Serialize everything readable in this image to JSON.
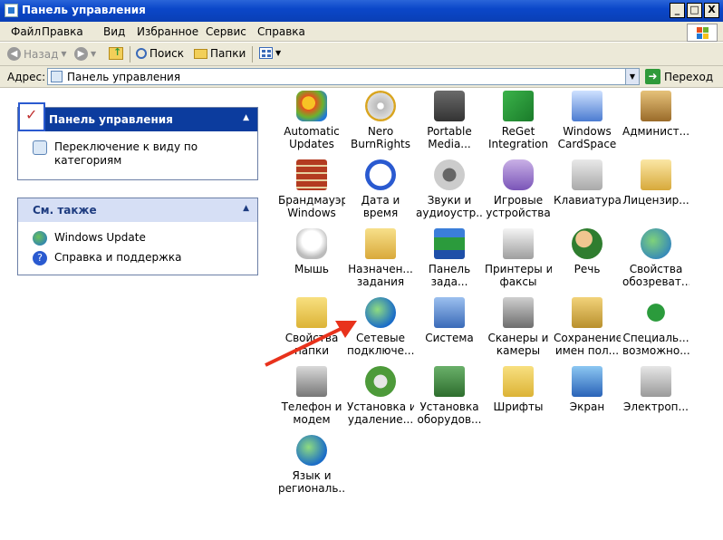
{
  "window": {
    "title": "Панель управления",
    "buttons": {
      "minimize": "_",
      "maximize": "□",
      "close": "X"
    }
  },
  "menu": [
    "Файл",
    "Правка",
    "Вид",
    "Избранное",
    "Сервис",
    "Справка"
  ],
  "toolbar": {
    "back": "Назад",
    "search": "Поиск",
    "folders": "Папки"
  },
  "address": {
    "label": "Адрес:",
    "value": "Панель управления",
    "go": "Переход"
  },
  "sidebar": {
    "panel1": {
      "title": "Панель управления",
      "link": "Переключение к виду по категориям"
    },
    "panel2": {
      "title": "См. также",
      "links": [
        "Windows Update",
        "Справка и поддержка"
      ]
    }
  },
  "icons": [
    {
      "line1": "Automatic",
      "line2": "Updates"
    },
    {
      "line1": "Nero",
      "line2": "BurnRights"
    },
    {
      "line1": "Portable",
      "line2": "Media..."
    },
    {
      "line1": "ReGet",
      "line2": "Integration"
    },
    {
      "line1": "Windows",
      "line2": "CardSpace"
    },
    {
      "line1": "Админист...",
      "line2": ""
    },
    {
      "line1": "Брандмауэр",
      "line2": "Windows"
    },
    {
      "line1": "Дата и",
      "line2": "время"
    },
    {
      "line1": "Звуки и",
      "line2": "аудиоустр..."
    },
    {
      "line1": "Игровые",
      "line2": "устройства"
    },
    {
      "line1": "Клавиатура",
      "line2": ""
    },
    {
      "line1": "Лицензир...",
      "line2": ""
    },
    {
      "line1": "Мышь",
      "line2": ""
    },
    {
      "line1": "Назначен...",
      "line2": "задания"
    },
    {
      "line1": "Панель",
      "line2": "зада..."
    },
    {
      "line1": "Принтеры и",
      "line2": "факсы"
    },
    {
      "line1": "Речь",
      "line2": ""
    },
    {
      "line1": "Свойства",
      "line2": "обозреват..."
    },
    {
      "line1": "Свойства",
      "line2": "папки"
    },
    {
      "line1": "Сетевые",
      "line2": "подключе..."
    },
    {
      "line1": "Система",
      "line2": ""
    },
    {
      "line1": "Сканеры и",
      "line2": "камеры"
    },
    {
      "line1": "Сохранение",
      "line2": "имен пол..."
    },
    {
      "line1": "Специаль...",
      "line2": "возможно..."
    },
    {
      "line1": "Телефон и",
      "line2": "модем"
    },
    {
      "line1": "Установка и",
      "line2": "удаление..."
    },
    {
      "line1": "Установка",
      "line2": "оборудов..."
    },
    {
      "line1": "Шрифты",
      "line2": ""
    },
    {
      "line1": "Экран",
      "line2": ""
    },
    {
      "line1": "Электроп...",
      "line2": ""
    },
    {
      "line1": "Язык и",
      "line2": "региональ..."
    }
  ]
}
